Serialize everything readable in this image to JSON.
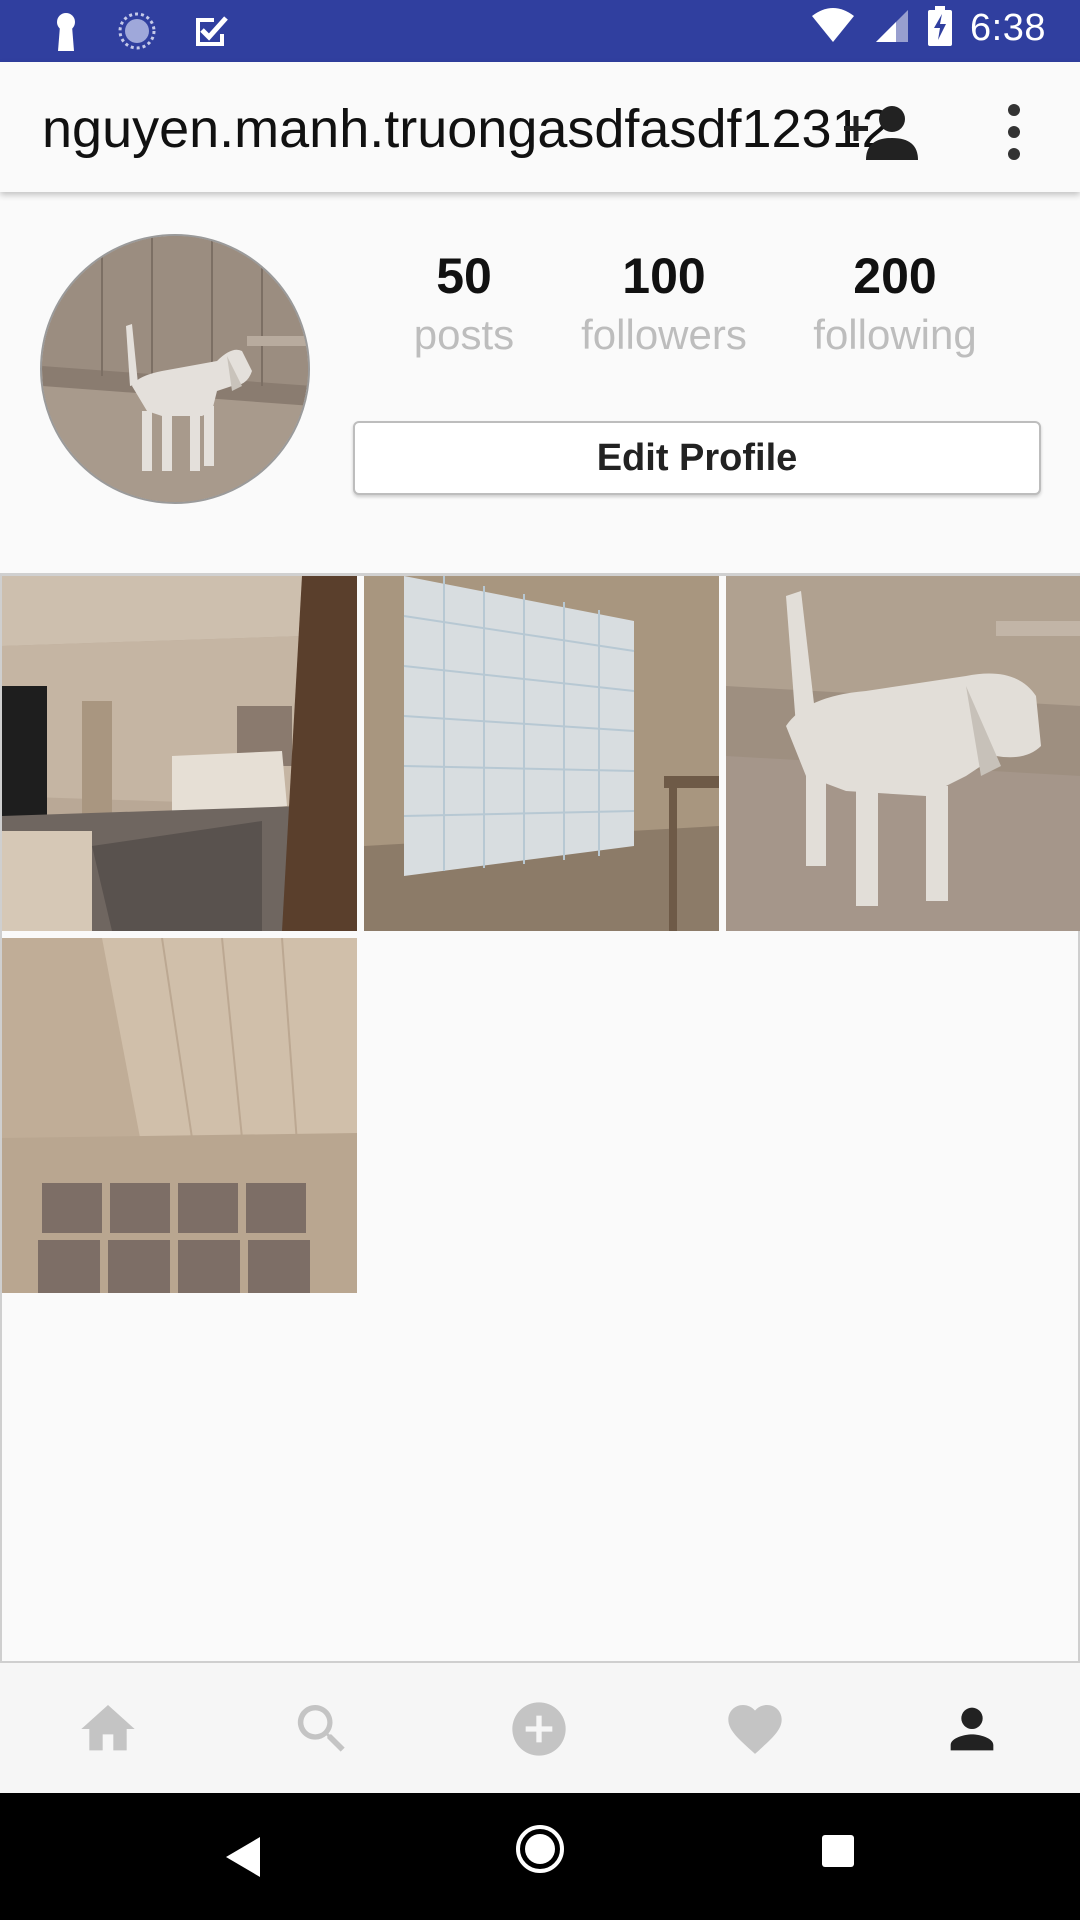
{
  "status_bar": {
    "time": "6:38",
    "icons": [
      "keyhole-icon",
      "loading-icon",
      "checkbox-icon",
      "wifi-icon",
      "signal-icon",
      "battery-charging-icon"
    ],
    "background": "#303f9f"
  },
  "toolbar": {
    "username": "nguyen.manh.truongasdfasdf12312",
    "add_person_icon": "add-person-icon",
    "overflow_icon": "more-vert-icon"
  },
  "profile": {
    "avatar": "dog-avatar",
    "stats": [
      {
        "value": "50",
        "label": "posts"
      },
      {
        "value": "100",
        "label": "followers"
      },
      {
        "value": "200",
        "label": "following"
      }
    ],
    "edit_button_label": "Edit Profile"
  },
  "posts": [
    {
      "subject": "living-room-photo"
    },
    {
      "subject": "grid-panel-photo"
    },
    {
      "subject": "dog-photo"
    },
    {
      "subject": "ceiling-panels-photo"
    }
  ],
  "bottom_nav": {
    "items": [
      "home-icon",
      "search-icon",
      "add-post-icon",
      "heart-icon",
      "profile-icon"
    ],
    "active": "profile-icon",
    "active_color": "#222222",
    "inactive_color": "#c4c4c4"
  },
  "system_nav": [
    "back-icon",
    "home-button-icon",
    "recents-icon"
  ]
}
